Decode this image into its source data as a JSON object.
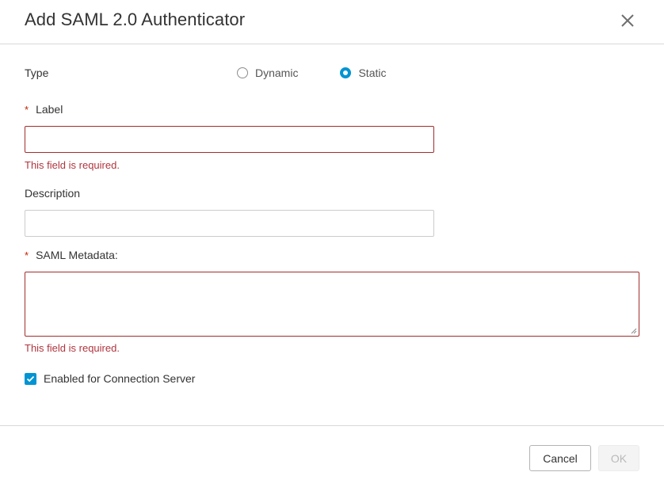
{
  "dialog": {
    "title": "Add SAML 2.0 Authenticator"
  },
  "form": {
    "type": {
      "label": "Type",
      "options": [
        "Dynamic",
        "Static"
      ],
      "selected": "Static"
    },
    "label_field": {
      "label": "Label",
      "required_marker": "*",
      "value": "",
      "error": "This field is required."
    },
    "description_field": {
      "label": "Description",
      "value": ""
    },
    "metadata_field": {
      "label": "SAML Metadata:",
      "required_marker": "*",
      "value": "",
      "error": "This field is required."
    },
    "enabled_checkbox": {
      "label": "Enabled for Connection Server",
      "checked": true
    }
  },
  "footer": {
    "cancel_label": "Cancel",
    "ok_label": "OK"
  },
  "colors": {
    "accent": "#0094d2",
    "error": "#b0353e",
    "invalid_border": "#a32d2d"
  }
}
